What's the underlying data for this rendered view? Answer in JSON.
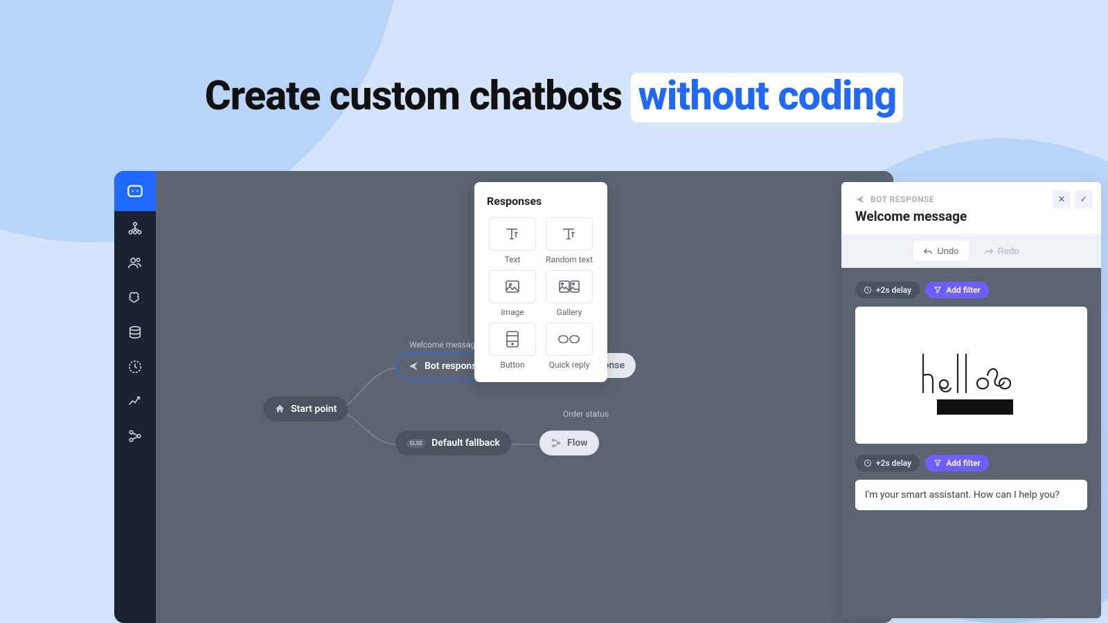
{
  "headline": {
    "plain": "Create custom chatbots ",
    "highlight": "without coding"
  },
  "canvas": {
    "start": "Start point",
    "welcome_label": "Welcome message",
    "bot_response": "Bot response",
    "order_label": "Order status",
    "fallback_else": "ELSE",
    "fallback": "Default fallback",
    "flow": "Flow"
  },
  "responses": {
    "title": "Responses",
    "items": [
      {
        "label": "Text"
      },
      {
        "label": "Random text"
      },
      {
        "label": "Image"
      },
      {
        "label": "Gallery"
      },
      {
        "label": "Button"
      },
      {
        "label": "Quick reply"
      }
    ]
  },
  "panel": {
    "label": "BOT RESPONSE",
    "title": "Welcome message",
    "undo": "Undo",
    "redo": "Redo",
    "delay": "+2s delay",
    "filter": "Add filter",
    "message": "I'm your smart assistant. How can I help you?"
  }
}
